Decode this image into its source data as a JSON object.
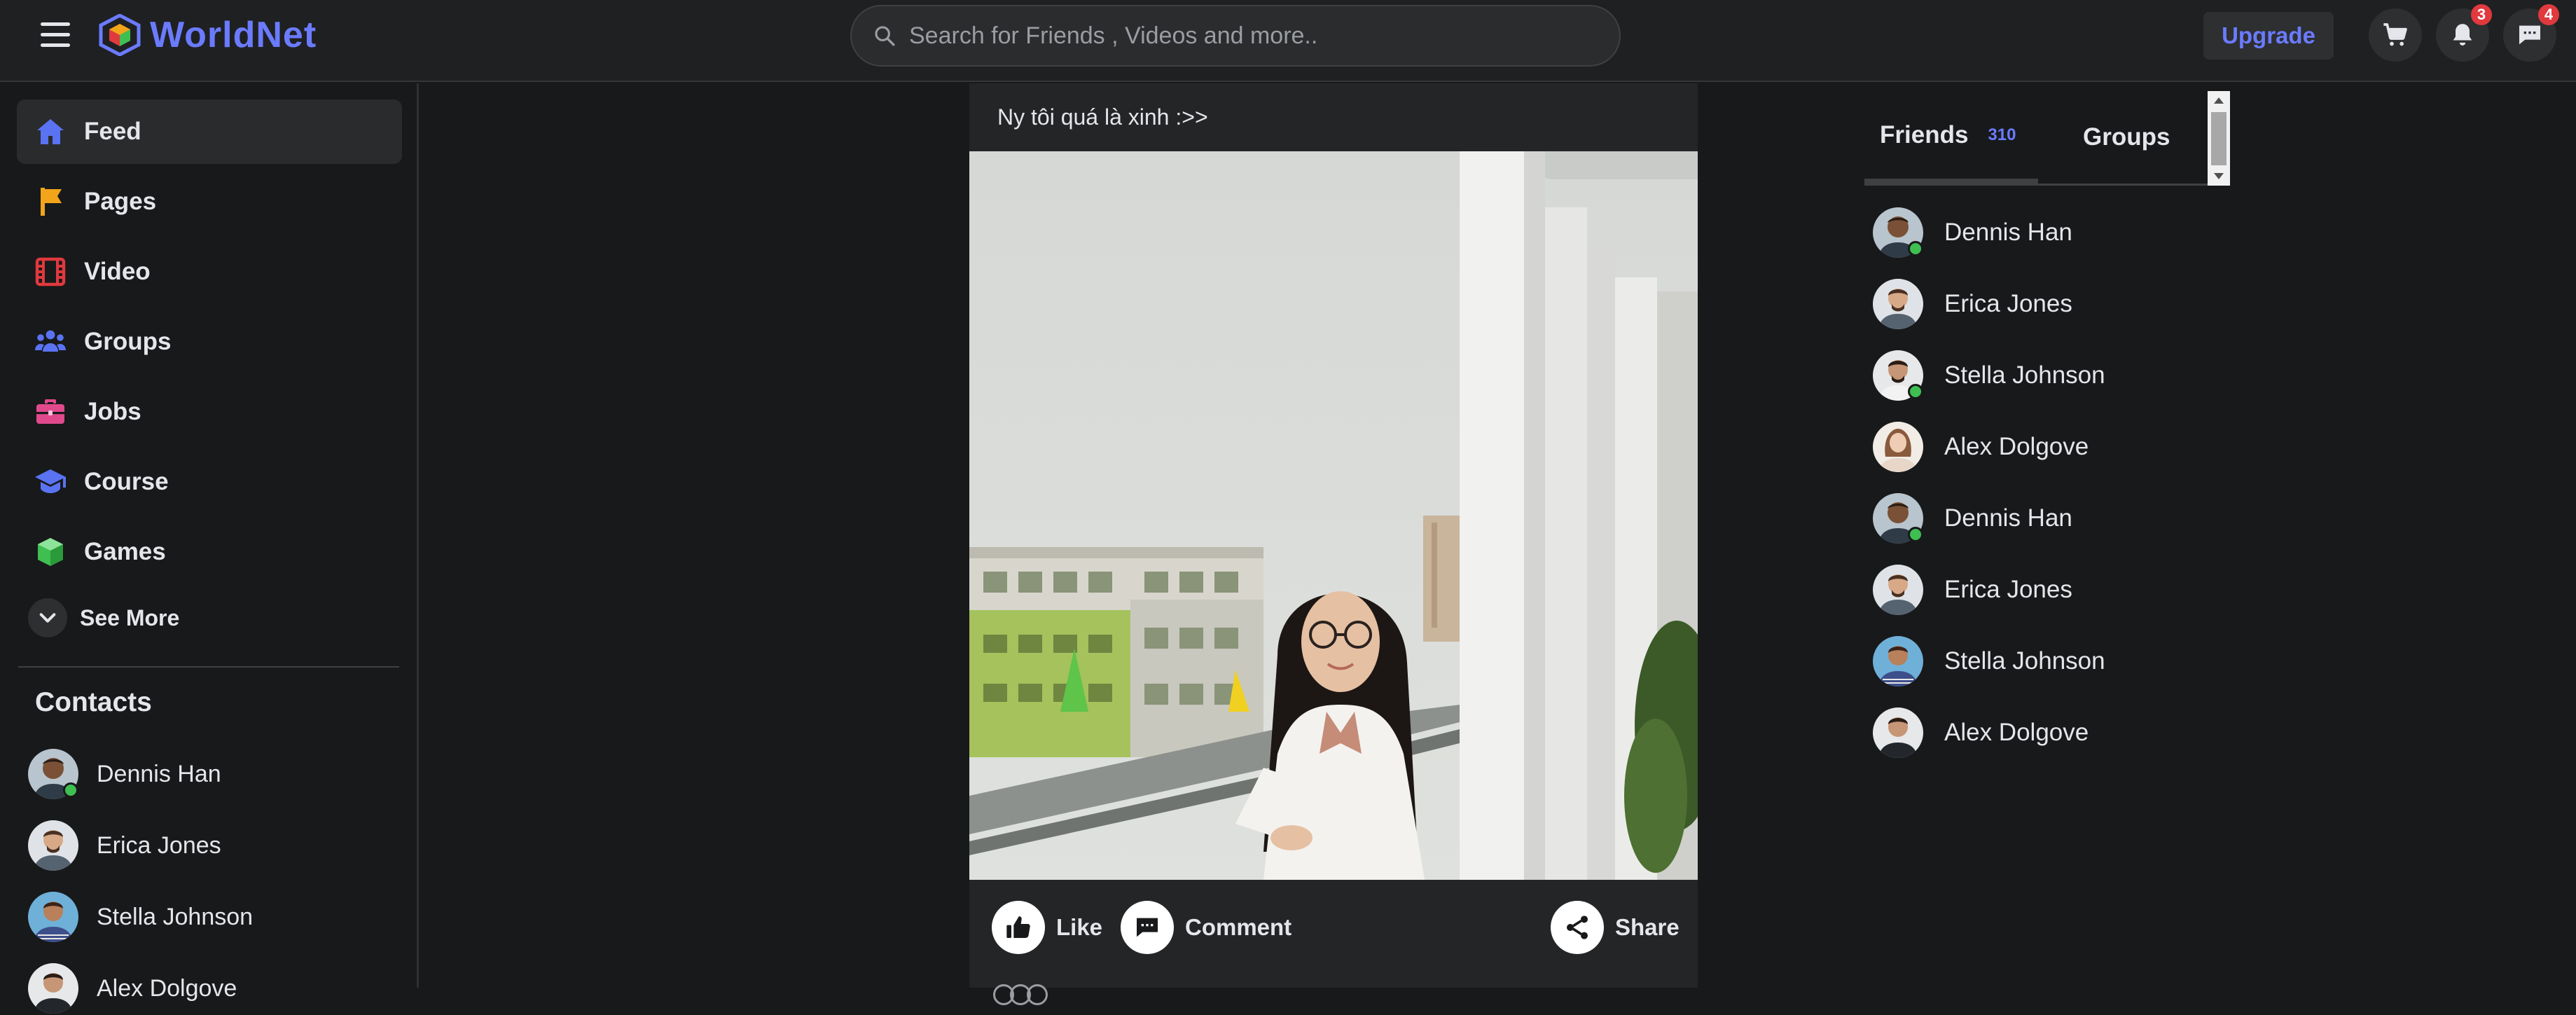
{
  "header": {
    "brand": "WorldNet",
    "search_placeholder": "Search for Friends , Videos and more..",
    "upgrade_label": "Upgrade",
    "notification_count": "3",
    "message_count": "4",
    "colors": {
      "accent": "#6b7bff",
      "badge": "#e0393e",
      "background": "#1f2022"
    }
  },
  "sidebar": {
    "items": [
      {
        "label": "Feed",
        "icon": "home-icon",
        "color": "#5a73f2"
      },
      {
        "label": "Pages",
        "icon": "flag-icon",
        "color": "#f2a51a"
      },
      {
        "label": "Video",
        "icon": "film-icon",
        "color": "#e0393e"
      },
      {
        "label": "Groups",
        "icon": "people-icon",
        "color": "#5a73f2"
      },
      {
        "label": "Jobs",
        "icon": "briefcase-icon",
        "color": "#e04a8c"
      },
      {
        "label": "Course",
        "icon": "graduation-cap-icon",
        "color": "#5a73f2"
      },
      {
        "label": "Games",
        "icon": "cube-icon",
        "color": "#3fbf52"
      }
    ],
    "see_more": "See More",
    "contacts_title": "Contacts",
    "contacts": [
      {
        "name": "Dennis Han",
        "online": true
      },
      {
        "name": "Erica Jones",
        "online": false
      },
      {
        "name": "Stella Johnson",
        "online": false
      },
      {
        "name": "Alex Dolgove",
        "online": false
      }
    ]
  },
  "post": {
    "caption": "Ny tôi quá là xinh :>>",
    "image_icon": "photo-girl-balcony",
    "actions": {
      "like": "Like",
      "comment": "Comment",
      "share": "Share"
    }
  },
  "friends_panel": {
    "tab_friends": "Friends",
    "friends_count": "310",
    "tab_groups": "Groups",
    "friends": [
      {
        "name": "Dennis Han",
        "online": true
      },
      {
        "name": "Erica Jones",
        "online": false
      },
      {
        "name": "Stella Johnson",
        "online": true
      },
      {
        "name": "Alex Dolgove",
        "online": false
      },
      {
        "name": "Dennis Han",
        "online": true
      },
      {
        "name": "Erica Jones",
        "online": false
      },
      {
        "name": "Stella Johnson",
        "online": false
      },
      {
        "name": "Alex Dolgove",
        "online": false
      }
    ]
  }
}
